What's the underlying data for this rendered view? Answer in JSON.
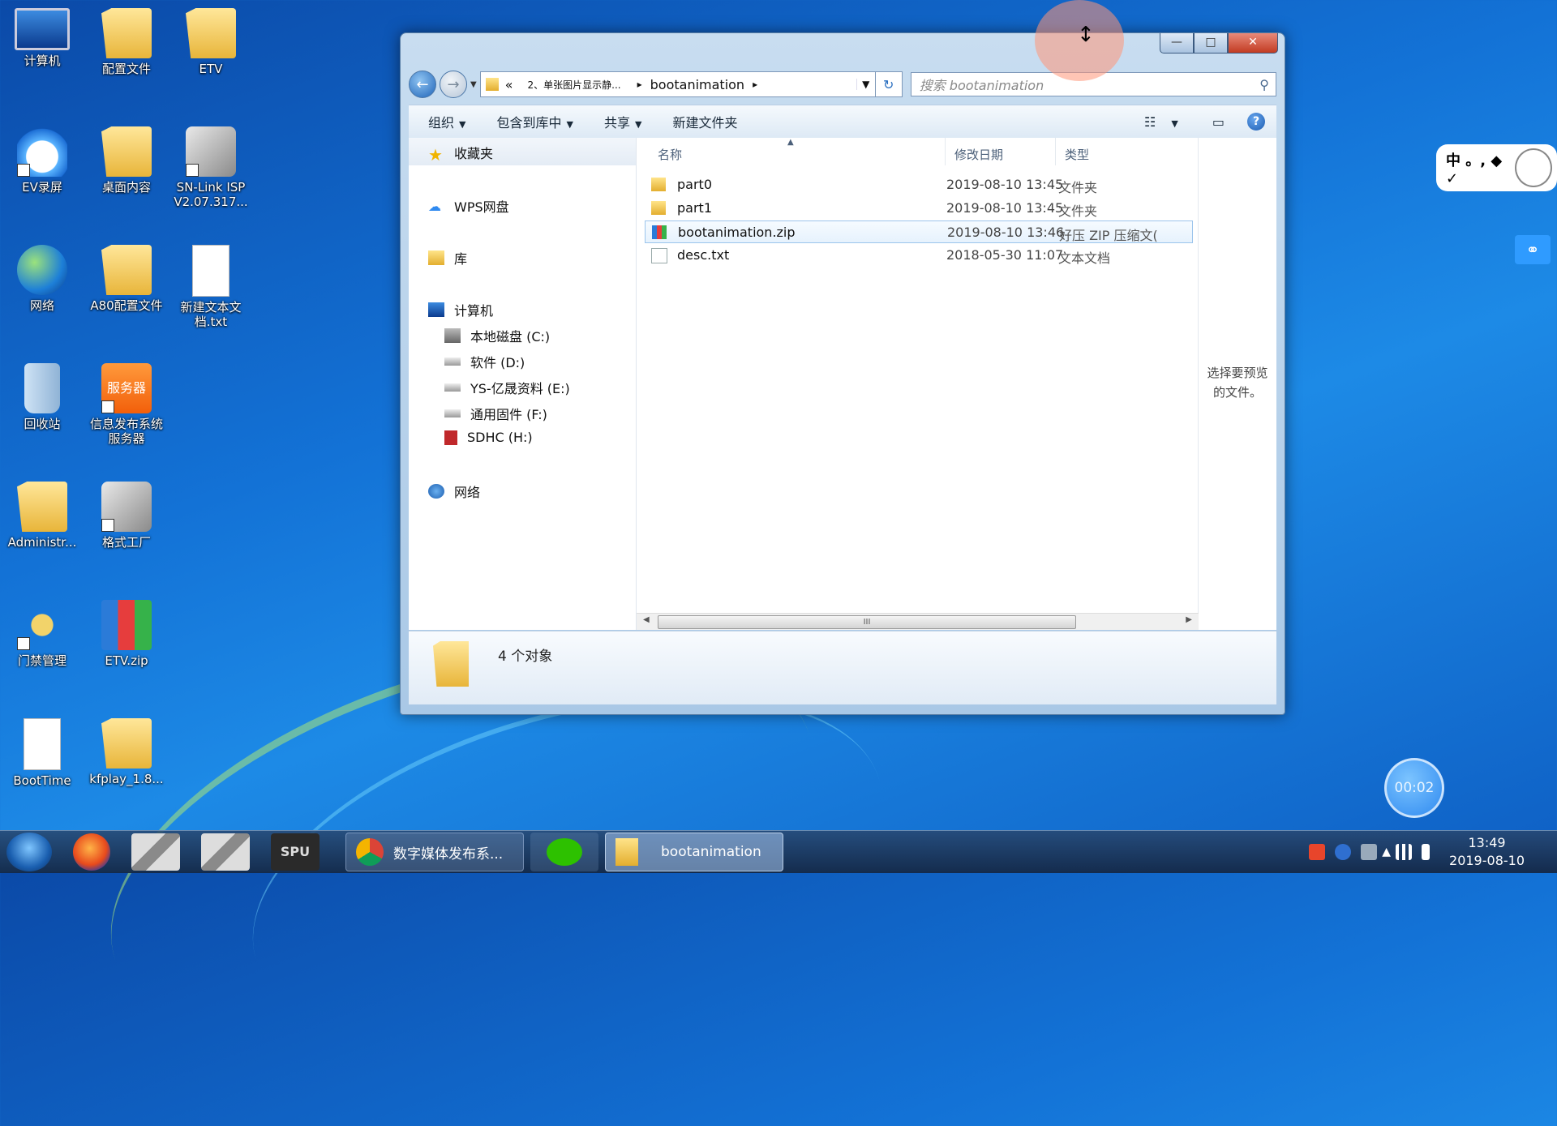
{
  "desktop": {
    "icons": [
      {
        "label": "计算机"
      },
      {
        "label": "配置文件"
      },
      {
        "label": "ETV"
      },
      {
        "label": "EV录屏"
      },
      {
        "label": "桌面内容"
      },
      {
        "label": "SN-Link ISP V2.07.317..."
      },
      {
        "label": "网络"
      },
      {
        "label": "A80配置文件"
      },
      {
        "label": "新建文本文档.txt"
      },
      {
        "label": "回收站"
      },
      {
        "label": "信息发布系统服务器",
        "badge": "服务器"
      },
      {
        "label": "Administr..."
      },
      {
        "label": "格式工厂"
      },
      {
        "label": "门禁管理"
      },
      {
        "label": "ETV.zip"
      },
      {
        "label": "BootTime"
      },
      {
        "label": "kfplay_1.8..."
      }
    ]
  },
  "window": {
    "caption_buttons": {
      "minimize": "—",
      "maximize": "□",
      "close": "✕"
    },
    "nav": {
      "back": "←",
      "forward": "→",
      "address": {
        "chevron": "«",
        "segments": [
          "2、单张图片显示静...",
          "bootanimation"
        ],
        "separator": "▸"
      },
      "refresh": "↻",
      "search_placeholder": "搜索 bootanimation"
    },
    "toolbar": {
      "organize": "组织",
      "include_in_library": "包含到库中",
      "share": "共享",
      "new_folder": "新建文件夹",
      "dropdown_arrow": "▼"
    },
    "sidebar": {
      "favorites": "收藏夹",
      "wps": "WPS网盘",
      "libraries": "库",
      "computer": "计算机",
      "drives": [
        {
          "label": "本地磁盘 (C:)"
        },
        {
          "label": "软件 (D:)"
        },
        {
          "label": "YS-亿晟资料 (E:)"
        },
        {
          "label": "通用固件 (F:)"
        },
        {
          "label": "SDHC (H:)"
        }
      ],
      "network": "网络"
    },
    "columns": {
      "name": "名称",
      "date": "修改日期",
      "type": "类型"
    },
    "files": [
      {
        "name": "part0",
        "date": "2019-08-10 13:45",
        "type": "文件夹",
        "icon": "folder-icon"
      },
      {
        "name": "part1",
        "date": "2019-08-10 13:45",
        "type": "文件夹",
        "icon": "folder-icon"
      },
      {
        "name": "bootanimation.zip",
        "date": "2019-08-10 13:46",
        "type": "好压 ZIP 压缩文(",
        "icon": "zip-icon",
        "selected": true
      },
      {
        "name": "desc.txt",
        "date": "2018-05-30 11:07",
        "type": "文本文档",
        "icon": "text-file-icon"
      }
    ],
    "preview_hint": "选择要预览的文件。",
    "scroll_grip": "III",
    "status": "4 个对象"
  },
  "overlays": {
    "ime_text": "中 。, ◆ ✓",
    "timer": "00:02"
  },
  "taskbar": {
    "spu_label": "SPU",
    "tasks": [
      {
        "label": "数字媒体发布系..."
      },
      {
        "label": ""
      },
      {
        "label": "bootanimation"
      }
    ],
    "clock_time": "13:49",
    "clock_date": "2019-08-10"
  }
}
